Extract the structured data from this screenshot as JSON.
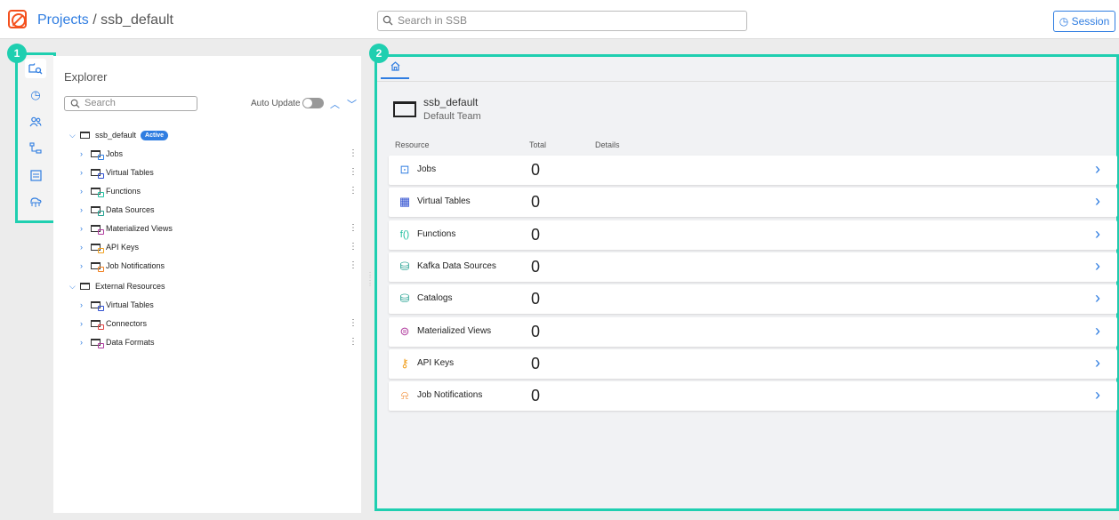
{
  "topbar": {
    "breadcrumb_projects": "Projects",
    "breadcrumb_sep": " / ",
    "breadcrumb_current": "ssb_default",
    "search_placeholder": "Search in SSB",
    "session_label": "Session"
  },
  "badges": {
    "rail": "1",
    "panel": "2"
  },
  "rail": {
    "items": [
      {
        "icon": "explorer-icon",
        "active": true
      },
      {
        "icon": "history-icon"
      },
      {
        "icon": "users-icon"
      },
      {
        "icon": "hierarchy-icon"
      },
      {
        "icon": "dashboard-icon"
      },
      {
        "icon": "cloud-network-icon"
      }
    ]
  },
  "explorer": {
    "title": "Explorer",
    "search_placeholder": "Search",
    "auto_update_label": "Auto Update",
    "auto_update_on": false,
    "tree": [
      {
        "label": "ssb_default",
        "badge": "Active",
        "level": 0,
        "expanded": true
      },
      {
        "label": "Jobs",
        "level": 1,
        "kebab": true
      },
      {
        "label": "Virtual Tables",
        "level": 1,
        "kebab": true
      },
      {
        "label": "Functions",
        "level": 1,
        "kebab": true
      },
      {
        "label": "Data Sources",
        "level": 1,
        "kebab": false
      },
      {
        "label": "Materialized Views",
        "level": 1,
        "kebab": true
      },
      {
        "label": "API Keys",
        "level": 1,
        "kebab": true
      },
      {
        "label": "Job Notifications",
        "level": 1,
        "kebab": true
      },
      {
        "label": "External Resources",
        "level": 0,
        "expanded": true
      },
      {
        "label": "Virtual Tables",
        "level": 1,
        "kebab": false
      },
      {
        "label": "Connectors",
        "level": 1,
        "kebab": true
      },
      {
        "label": "Data Formats",
        "level": 1,
        "kebab": true
      }
    ]
  },
  "panel": {
    "project_name": "ssb_default",
    "team_name": "Default Team",
    "headers": {
      "resource": "Resource",
      "total": "Total",
      "details": "Details"
    },
    "resources": [
      {
        "label": "Jobs",
        "total": "0",
        "icon": "jobs-icon",
        "color": "#2f7de1"
      },
      {
        "label": "Virtual Tables",
        "total": "0",
        "icon": "table-icon",
        "color": "#2f4fd0"
      },
      {
        "label": "Functions",
        "total": "0",
        "icon": "function-icon",
        "color": "#1fbf9f"
      },
      {
        "label": "Kafka Data Sources",
        "total": "0",
        "icon": "kafka-icon",
        "color": "#1f9f8f"
      },
      {
        "label": "Catalogs",
        "total": "0",
        "icon": "catalog-icon",
        "color": "#1f9f8f"
      },
      {
        "label": "Materialized Views",
        "total": "0",
        "icon": "materialized-view-icon",
        "color": "#b03a9e"
      },
      {
        "label": "API Keys",
        "total": "0",
        "icon": "key-icon",
        "color": "#f0a020"
      },
      {
        "label": "Job Notifications",
        "total": "0",
        "icon": "bell-icon",
        "color": "#f08020"
      }
    ]
  }
}
